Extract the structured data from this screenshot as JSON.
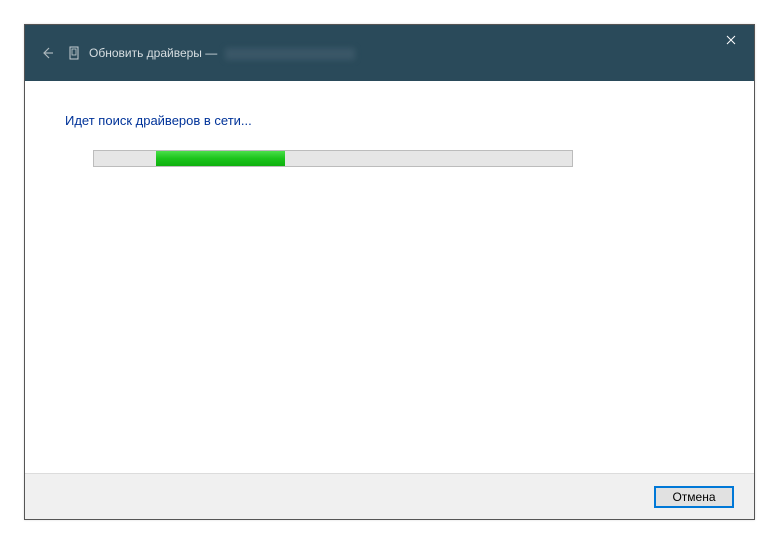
{
  "titlebar": {
    "title_prefix": "Обновить драйверы —"
  },
  "content": {
    "status": "Идет поиск драйверов в сети...",
    "progress": {
      "indeterminate_left_pct": 13,
      "indeterminate_width_pct": 27
    }
  },
  "footer": {
    "cancel_label": "Отмена"
  }
}
